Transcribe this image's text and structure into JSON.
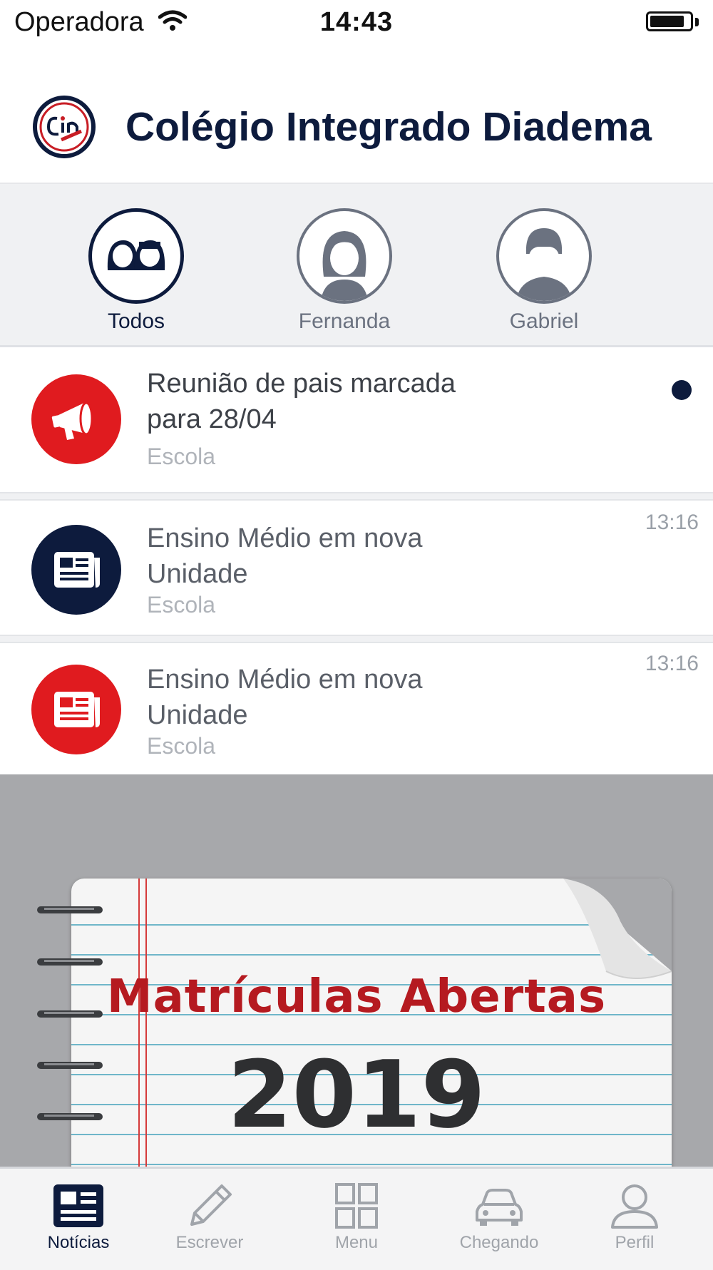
{
  "status_bar": {
    "carrier": "Operadora",
    "time": "14:43"
  },
  "header": {
    "school_name": "Colégio Integrado Diadema",
    "logo_text": "Cin COLÉGIO INTEGRADO"
  },
  "students": [
    {
      "label": "Todos",
      "icon": "two-people-icon",
      "active": true
    },
    {
      "label": "Fernanda",
      "icon": "girl-avatar-icon",
      "active": false
    },
    {
      "label": "Gabriel",
      "icon": "boy-avatar-icon",
      "active": false
    }
  ],
  "news": [
    {
      "title_line1": "Reunião de pais marcada",
      "title_line2": "para 28/04",
      "source": "Escola",
      "time": "",
      "icon": "megaphone-icon",
      "icon_color": "#e01b1f",
      "unread": true
    },
    {
      "title_line1": "Ensino Médio em nova",
      "title_line2": "Unidade",
      "source": "Escola",
      "time": "13:16",
      "icon": "newspaper-icon",
      "icon_color": "#0d1b3d",
      "unread": false
    },
    {
      "title_line1": "Ensino Médio em nova",
      "title_line2": "Unidade",
      "source": "Escola",
      "time": "13:16",
      "icon": "newspaper-icon",
      "icon_color": "#e01b1f",
      "unread": false
    }
  ],
  "banner": {
    "title": "Matrículas Abertas",
    "year": "2019"
  },
  "tabs": [
    {
      "label": "Notícias",
      "icon": "news-tab-icon",
      "active": true
    },
    {
      "label": "Escrever",
      "icon": "pencil-icon",
      "active": false
    },
    {
      "label": "Menu",
      "icon": "grid-icon",
      "active": false
    },
    {
      "label": "Chegando",
      "icon": "car-icon",
      "active": false
    },
    {
      "label": "Perfil",
      "icon": "person-icon",
      "active": false
    }
  ],
  "colors": {
    "navy": "#0d1b3d",
    "red": "#e01b1f",
    "gray": "#6b7280"
  }
}
